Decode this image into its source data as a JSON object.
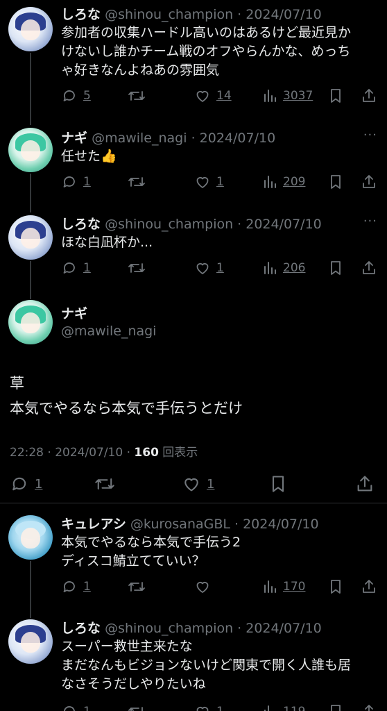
{
  "tweets": [
    {
      "name": "しろな",
      "meta": "@shinou_champion · 2024/07/10",
      "text": "参加者の収集ハードル高いのはあるけど最近見か\nけないし誰かチーム戦のオフやらんかな、めっち\nゃ好きなんよねあの雰囲気",
      "reply_count": "5",
      "like_count": "14",
      "view_count": "3037"
    },
    {
      "name": "ナギ",
      "meta": "@mawile_nagi · 2024/07/10",
      "text": "任せた👍",
      "reply_count": "1",
      "like_count": "1",
      "view_count": "209"
    },
    {
      "name": "しろな",
      "meta": "@shinou_champion · 2024/07/10",
      "text": "ほな白凪杯か...",
      "reply_count": "1",
      "like_count": "1",
      "view_count": "206"
    }
  ],
  "focus": {
    "name": "ナギ",
    "handle": "@mawile_nagi",
    "text": "草\n本気でやるなら本気で手伝うとだけ",
    "time_date": "22:28 · 2024/07/10 · ",
    "views": "160",
    "views_label": " 回表示",
    "reply_count": "1",
    "like_count": "1"
  },
  "replies": [
    {
      "name": "キュレアシ",
      "meta": "@kurosanaGBL · 2024/07/10",
      "text": "本気でやるなら本気で手伝う2\nディスコ鯖立てていい？",
      "reply_count": "1",
      "view_count": "170"
    },
    {
      "name": "しろな",
      "meta": "@shinou_champion · 2024/07/10",
      "text": "スーパー救世主来たな\nまだなんもビジョンないけど関東で開く人誰も居\nなさそうだしやりたいね",
      "reply_count": "1",
      "like_count": "1",
      "view_count": "119"
    }
  ],
  "more_label": "···",
  "icons": [
    "reply-icon",
    "retweet-icon",
    "like-icon",
    "views-icon",
    "bookmark-icon",
    "share-icon",
    "more-icon"
  ],
  "colors": {
    "background": "#000000",
    "text": "#e7e9ea",
    "muted": "#71767b",
    "divider": "#2f3336"
  }
}
